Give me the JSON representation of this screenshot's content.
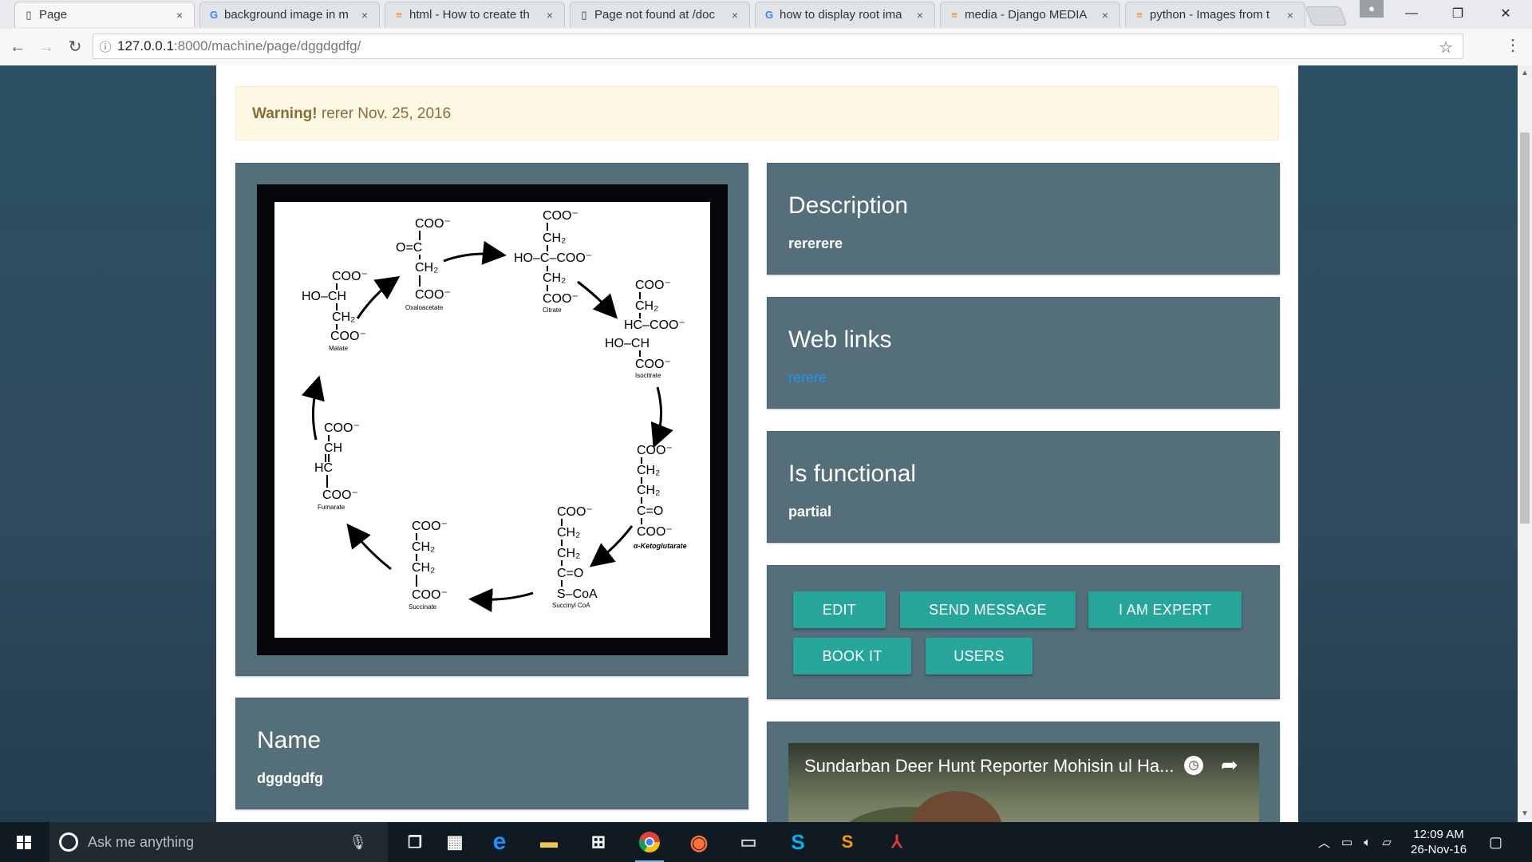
{
  "browser": {
    "tabs": [
      {
        "label": "Page",
        "icon": "page-icon",
        "active": true
      },
      {
        "label": "background image in m",
        "icon": "google-icon"
      },
      {
        "label": "html - How to create th",
        "icon": "stackoverflow-icon"
      },
      {
        "label": "Page not found at /doc",
        "icon": "page-icon"
      },
      {
        "label": "how to display root ima",
        "icon": "google-icon"
      },
      {
        "label": "media - Django MEDIA",
        "icon": "stackoverflow-icon"
      },
      {
        "label": "python - Images from t",
        "icon": "stackoverflow-icon"
      }
    ],
    "close_glyph": "×",
    "url_host": "127.0.0.1",
    "url_path": ":8000/machine/page/dggdgdfg/"
  },
  "page": {
    "alert": {
      "strong": "Warning!",
      "text": " rerer Nov. 25, 2016"
    },
    "description": {
      "title": "Description",
      "value": "rererere"
    },
    "weblinks": {
      "title": "Web links",
      "link": "rerere"
    },
    "functional": {
      "title": "Is functional",
      "value": "partial"
    },
    "name": {
      "title": "Name",
      "value": "dggdgdfg"
    },
    "buttons": {
      "edit": "EDIT",
      "send_message": "SEND MESSAGE",
      "expert": "I AM EXPERT",
      "book": "BOOK IT",
      "users": "USERS"
    },
    "video": {
      "title": "Sundarban Deer Hunt Reporter Mohisin ul Ha..."
    },
    "diagram": {
      "oxaloacetate": [
        "COO⁻",
        "O=C",
        "CH₂",
        "COO⁻"
      ],
      "oxaloacetate_label": "Oxaloacetate",
      "citrate": [
        "COO⁻",
        "CH₂",
        "HO–C–COO⁻",
        "CH₂",
        "COO⁻"
      ],
      "citrate_label": "Citrate",
      "isocitrate": [
        "COO⁻",
        "CH₂",
        "HC–COO⁻",
        "HO–CH",
        "COO⁻"
      ],
      "isocitrate_label": "Isocitrate",
      "ketoglutarate": [
        "COO⁻",
        "CH₂",
        "CH₂",
        "C=O",
        "COO⁻"
      ],
      "ketoglutarate_label": "α-Ketoglutarate",
      "succinylcoa": [
        "COO⁻",
        "CH₂",
        "CH₂",
        "C=O",
        "S–CoA"
      ],
      "succinylcoa_label": "Succinyl CoA",
      "succinate": [
        "COO⁻",
        "CH₂",
        "CH₂",
        "COO⁻"
      ],
      "succinate_label": "Succinate",
      "fumarate": [
        "COO⁻",
        "CH",
        "HC",
        "COO⁻"
      ],
      "fumarate_label": "Fumarate",
      "malate": [
        "COO⁻",
        "HO–CH",
        "CH₂",
        "COO⁻"
      ],
      "malate_label": "Malate"
    }
  },
  "taskbar": {
    "search_placeholder": "Ask me anything",
    "time": "12:09 AM",
    "date": "26-Nov-16"
  },
  "colors": {
    "panel": "#546e7a",
    "button": "#26a69a",
    "link": "#2196f3",
    "alert_bg": "#fcf8e3"
  }
}
